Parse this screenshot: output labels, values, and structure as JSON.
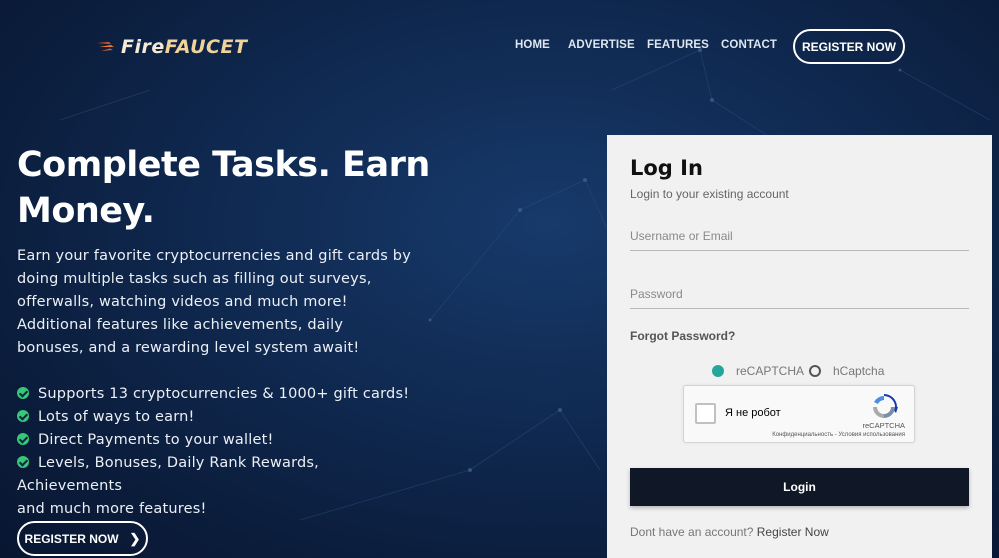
{
  "logo": {
    "part1": "Fire",
    "part2": "FAUCET",
    "icon": "flame-icon"
  },
  "nav": {
    "items": [
      "HOME",
      "ADVERTISE",
      "FEATURES",
      "CONTACT"
    ],
    "register_label": "REGISTER NOW"
  },
  "hero": {
    "title": "Complete Tasks. Earn Money.",
    "description": "Earn your favorite cryptocurrencies and gift cards by doing multiple tasks such as filling out surveys, offerwalls, watching videos and much more! Additional features like achievements, daily bonuses, and a rewarding level system await!",
    "features": [
      "Supports 13 cryptocurrencies & 1000+ gift cards!",
      "Lots of ways to earn!",
      "Direct Payments to your wallet!",
      "Levels, Bonuses, Daily Rank Rewards, Achievements"
    ],
    "features_tail": "and much more features!",
    "register_label": "REGISTER NOW",
    "register_icon": "chevron-right-icon"
  },
  "login": {
    "title": "Log In",
    "subtitle": "Login to your existing account",
    "username_placeholder": "Username or Email",
    "password_placeholder": "Password",
    "forgot_label": "Forgot Password?",
    "captcha_options": [
      "reCAPTCHA",
      "hCaptcha"
    ],
    "captcha_selected": "reCAPTCHA",
    "recaptcha": {
      "checkbox_label": "Я не робот",
      "brand": "reCAPTCHA",
      "terms": "Конфиденциальность - Условия использования"
    },
    "submit_label": "Login",
    "footer_text": "Dont have an account?",
    "footer_link": "Register Now"
  },
  "colors": {
    "background": "#0f2a52",
    "accent_green": "#35c877",
    "radio_teal": "#26a69a",
    "login_button": "#101828",
    "card_bg": "#f1f1f1"
  }
}
